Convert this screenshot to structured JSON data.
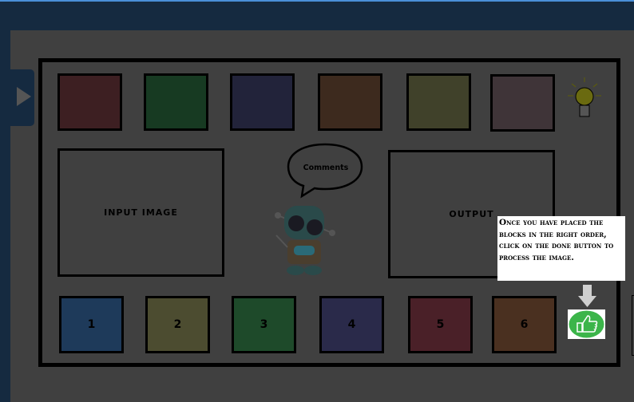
{
  "palette": [
    {
      "color": "#3d1f22"
    },
    {
      "color": "#173a22"
    },
    {
      "color": "#22233a"
    },
    {
      "color": "#3d2a1e"
    },
    {
      "color": "#40412a"
    },
    {
      "color": "#3f3438"
    }
  ],
  "slots": [
    {
      "label": "1",
      "color": "#1e3a5a"
    },
    {
      "label": "2",
      "color": "#4c4c30"
    },
    {
      "label": "3",
      "color": "#1e4a2a"
    },
    {
      "label": "4",
      "color": "#2a2a4a"
    },
    {
      "label": "5",
      "color": "#4a2028"
    },
    {
      "label": "6",
      "color": "#4a3020"
    }
  ],
  "input_label": "Input Image",
  "output_label": "Output",
  "comments_label": "Comments",
  "tooltip": "Once you have placed the blocks in the right order, click on the done button to process the image.",
  "icons": {
    "hint": "lightbulb-icon",
    "done": "thumbs-up-icon",
    "panel_toggle": "play-triangle-icon"
  },
  "colors": {
    "header": "#152a40",
    "done": "#3cb54a"
  }
}
